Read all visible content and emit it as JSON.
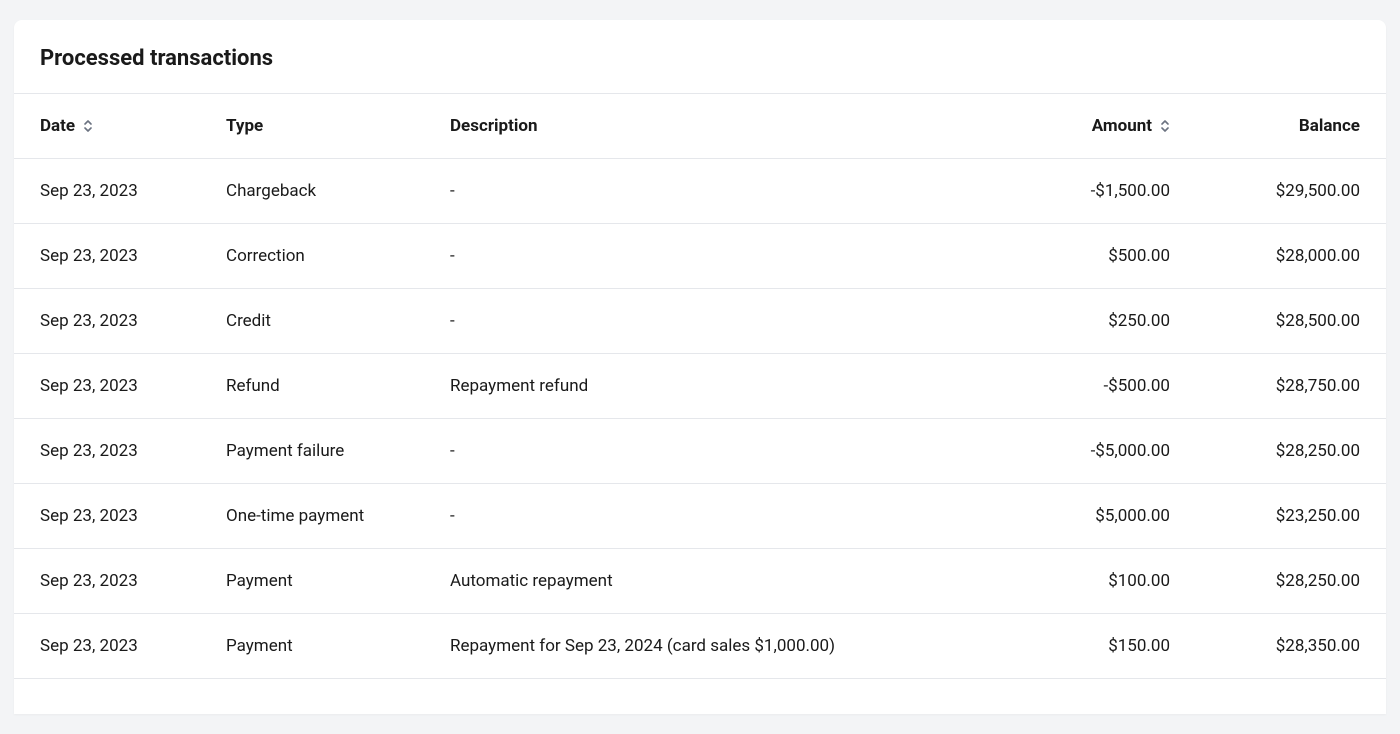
{
  "title": "Processed transactions",
  "columns": {
    "date": "Date",
    "type": "Type",
    "description": "Description",
    "amount": "Amount",
    "balance": "Balance"
  },
  "rows": [
    {
      "date": "Sep 23, 2023",
      "type": "Chargeback",
      "description": "-",
      "amount": "-$1,500.00",
      "balance": "$29,500.00"
    },
    {
      "date": "Sep 23, 2023",
      "type": "Correction",
      "description": "-",
      "amount": "$500.00",
      "balance": "$28,000.00"
    },
    {
      "date": "Sep 23, 2023",
      "type": "Credit",
      "description": "-",
      "amount": "$250.00",
      "balance": "$28,500.00"
    },
    {
      "date": "Sep 23, 2023",
      "type": "Refund",
      "description": "Repayment refund",
      "amount": "-$500.00",
      "balance": "$28,750.00"
    },
    {
      "date": "Sep 23, 2023",
      "type": "Payment failure",
      "description": "-",
      "amount": "-$5,000.00",
      "balance": "$28,250.00"
    },
    {
      "date": "Sep 23, 2023",
      "type": "One-time payment",
      "description": "-",
      "amount": "$5,000.00",
      "balance": "$23,250.00"
    },
    {
      "date": "Sep 23, 2023",
      "type": "Payment",
      "description": "Automatic repayment",
      "amount": "$100.00",
      "balance": "$28,250.00"
    },
    {
      "date": "Sep 23, 2023",
      "type": "Payment",
      "description": "Repayment for Sep 23, 2024 (card sales $1,000.00)",
      "amount": "$150.00",
      "balance": "$28,350.00"
    }
  ]
}
